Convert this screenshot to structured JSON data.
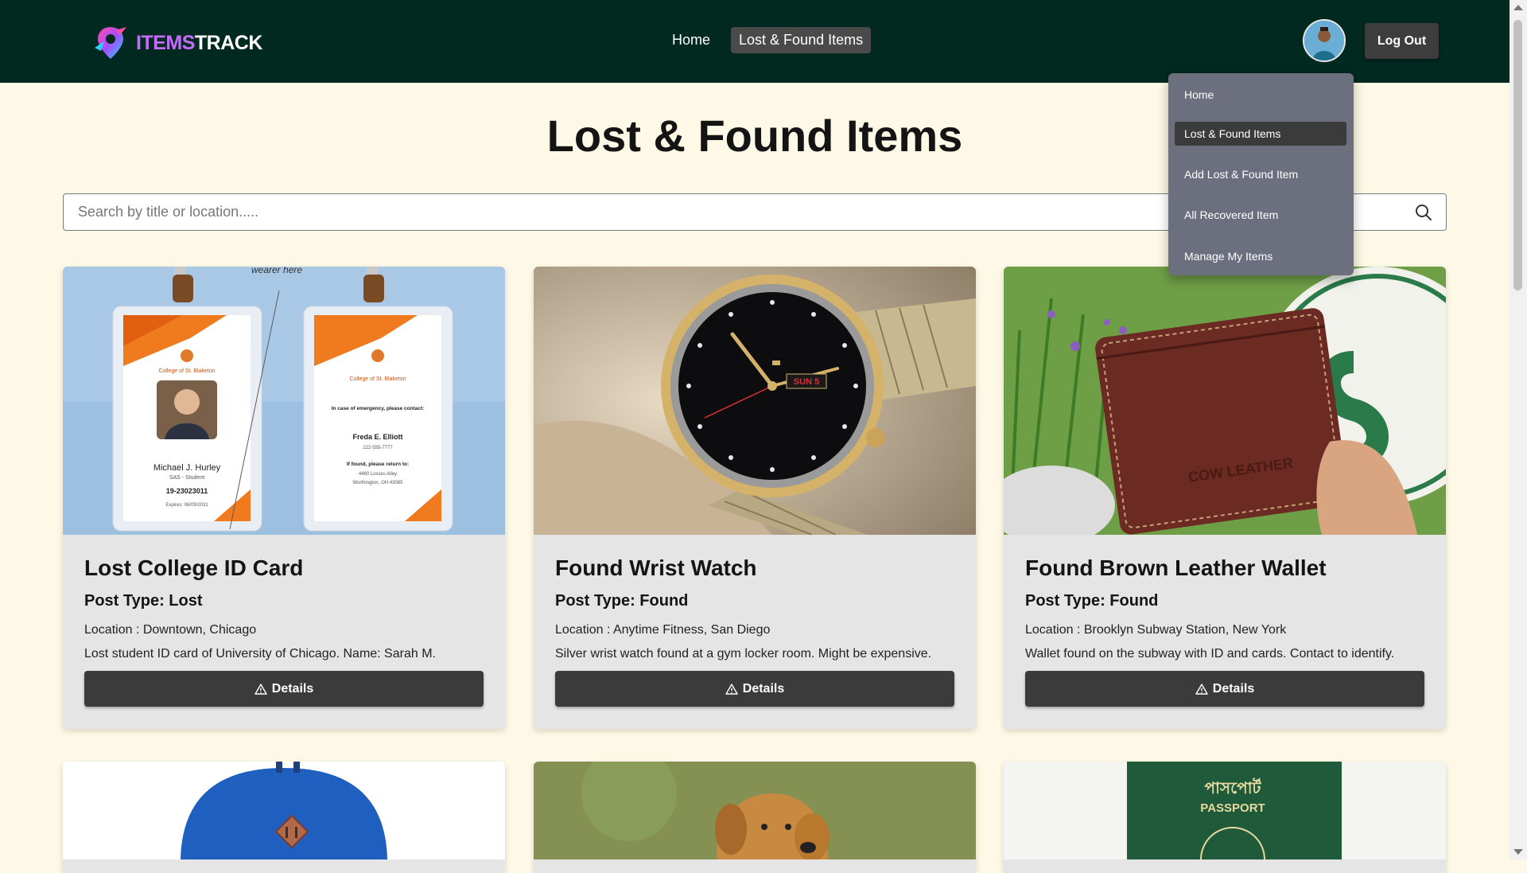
{
  "brand": {
    "part1": "ITEMS",
    "part2": "TRACK"
  },
  "nav": {
    "home": "Home",
    "lost_found": "Lost & Found Items"
  },
  "header": {
    "logout": "Log Out"
  },
  "dropdown": {
    "items": [
      {
        "label": "Home"
      },
      {
        "label": "Lost & Found Items",
        "active": true
      },
      {
        "label": "Add Lost & Found Item"
      },
      {
        "label": "All Recovered Item"
      },
      {
        "label": "Manage My Items"
      }
    ]
  },
  "page": {
    "title": "Lost & Found Items"
  },
  "search": {
    "placeholder": "Search by title or location....."
  },
  "cards": [
    {
      "title": "Lost College ID Card",
      "post_type": "Post Type: Lost",
      "location": "Location : Downtown, Chicago",
      "description": "Lost student ID card of University of Chicago. Name: Sarah M.",
      "button": "Details",
      "image_text": {
        "caption": "wearer here",
        "college": "College of St. Blaketon",
        "name": "Michael J. Hurley",
        "role": "SAS - Student",
        "id": "19-23023011",
        "expires": "Expires: 06/09/2031",
        "emergency": "In case of emergency, please contact:",
        "contact_name": "Freda E. Elliott",
        "contact_phone": "222-555-7777",
        "return_note": "If found, please return to:",
        "address1": "4460 Losses Alley",
        "address2": "Worthington, OH 43085"
      }
    },
    {
      "title": "Found Wrist Watch",
      "post_type": "Post Type: Found",
      "location": "Location : Anytime Fitness, San Diego",
      "description": "Silver wrist watch found at a gym locker room. Might be expensive.",
      "button": "Details",
      "image_text": {
        "day": "SUN 5"
      }
    },
    {
      "title": "Found Brown Leather Wallet",
      "post_type": "Post Type: Found",
      "location": "Location : Brooklyn Subway Station, New York",
      "description": "Wallet found on the subway with ID and cards. Contact to identify.",
      "button": "Details",
      "image_text": {
        "emboss": "COW LEATHER"
      }
    }
  ],
  "partial_cards": [
    {
      "image": "blue-backpack"
    },
    {
      "image": "golden-retriever"
    },
    {
      "image": "green-passport",
      "image_text": {
        "bangla": "পাসপোর্ট",
        "english": "PASSPORT"
      }
    }
  ],
  "colors": {
    "navbar": "#02291f",
    "page_bg": "#fef9e6",
    "card_bg": "#e5e5e5",
    "button_bg": "#3b3b3b",
    "dropdown_bg": "#6b6f7e",
    "logo_accent": "#c56cff"
  }
}
